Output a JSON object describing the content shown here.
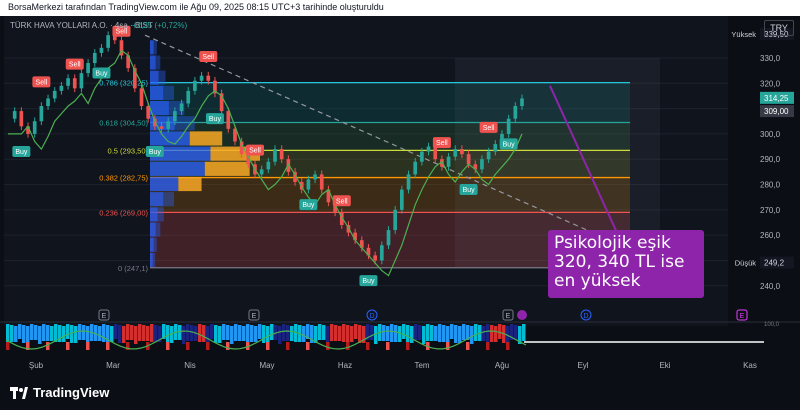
{
  "header": {
    "attribution": "BorsaMerkezi tarafından TradingView.com ile Ağu 09, 2025 08:15 UTC+3 tarihinde oluşturuldu",
    "symbol": "TÜRK HAVA YOLLARI A.O. · 4sa · BIST",
    "change": "+2,25 (+0,72%)",
    "currency": "TRY"
  },
  "callout": {
    "lines": [
      "Psikolojik eşik",
      "320, 340 TL ise",
      "en yüksek"
    ]
  },
  "footer": {
    "brand": "TradingView"
  },
  "colors": {
    "background": "#0b0e15",
    "up": "#26a69a",
    "down": "#ef5350",
    "fib_line": "#26c6da",
    "callout": "#8e24aa",
    "volume_profile": "#2962ff",
    "volume_profile_orange": "#f9a825"
  },
  "chart_data": {
    "type": "line",
    "title": "",
    "xlabel": "",
    "ylabel": "",
    "ylim": [
      232,
      345
    ],
    "x_ticks": [
      "Şub",
      "Mar",
      "Nis",
      "May",
      "Haz",
      "Tem",
      "Ağu",
      "Eyl",
      "Eki",
      "Kas"
    ],
    "y_ticks": [
      240,
      250,
      260,
      270,
      280,
      290,
      300,
      310,
      320,
      330
    ],
    "price_labels": [
      {
        "label": "Yüksek",
        "value": "339,50"
      },
      {
        "label": "",
        "value": "314,25"
      },
      {
        "label": "",
        "value": "309,00"
      },
      {
        "label": "Düşük",
        "value": "249,2"
      }
    ],
    "fib_levels": [
      {
        "ratio": "0",
        "value": 247.1,
        "label": "0 (247,1)"
      },
      {
        "ratio": "0.236",
        "value": 269.0,
        "label": "0.236 (269,00)"
      },
      {
        "ratio": "0.382",
        "value": 282.75,
        "label": "0.382 (282,75)"
      },
      {
        "ratio": "0.5",
        "value": 293.5,
        "label": "0.5 (293,50)"
      },
      {
        "ratio": "0.618",
        "value": 304.5,
        "label": "0.618 (304,50)"
      },
      {
        "ratio": "0.786",
        "value": 320.25,
        "label": "0.786 (320,25)"
      }
    ],
    "series": [
      {
        "values": [
          306,
          309,
          303,
          300,
          305,
          311,
          314,
          317,
          319,
          322,
          318,
          324,
          328,
          332,
          334,
          339,
          337,
          331,
          326,
          318,
          311,
          306,
          303,
          302,
          305,
          309,
          312,
          317,
          321,
          323,
          321,
          316,
          309,
          302,
          297,
          292,
          288,
          284,
          286,
          289,
          294,
          290,
          285,
          281,
          278,
          282,
          284,
          278,
          273,
          269,
          264,
          261,
          258,
          255,
          252,
          250,
          256,
          262,
          270,
          278,
          284,
          289,
          293,
          295,
          290,
          287,
          291,
          294,
          292,
          288,
          286,
          290,
          293,
          296,
          300,
          306,
          311,
          314
        ]
      }
    ],
    "signals": [
      {
        "type": "Sell",
        "index": 5
      },
      {
        "type": "Buy",
        "index": 2
      },
      {
        "type": "Sell",
        "index": 10
      },
      {
        "type": "Buy",
        "index": 14
      },
      {
        "type": "Sell",
        "index": 17
      },
      {
        "type": "Buy",
        "index": 22
      },
      {
        "type": "Sell",
        "index": 30
      },
      {
        "type": "Buy",
        "index": 31
      },
      {
        "type": "Sell",
        "index": 37
      },
      {
        "type": "Buy",
        "index": 45
      },
      {
        "type": "Sell",
        "index": 50
      },
      {
        "type": "Buy",
        "index": 54
      },
      {
        "type": "Sell",
        "index": 65
      },
      {
        "type": "Buy",
        "index": 69
      },
      {
        "type": "Sell",
        "index": 72
      },
      {
        "type": "Buy",
        "index": 75
      }
    ],
    "volume_profile": [
      {
        "price": 334,
        "volume": 4
      },
      {
        "price": 328,
        "volume": 6
      },
      {
        "price": 322,
        "volume": 9
      },
      {
        "price": 316,
        "volume": 14
      },
      {
        "price": 310,
        "volume": 20
      },
      {
        "price": 304,
        "volume": 26
      },
      {
        "price": 298,
        "volume": 42
      },
      {
        "price": 292,
        "volume": 64
      },
      {
        "price": 286,
        "volume": 58
      },
      {
        "price": 280,
        "volume": 30
      },
      {
        "price": 274,
        "volume": 14
      },
      {
        "price": 268,
        "volume": 8
      },
      {
        "price": 262,
        "volume": 6
      },
      {
        "price": 256,
        "volume": 4
      },
      {
        "price": 250,
        "volume": 3
      }
    ],
    "event_markers": [
      "E",
      "E",
      "D",
      "E",
      "D",
      "E"
    ]
  }
}
